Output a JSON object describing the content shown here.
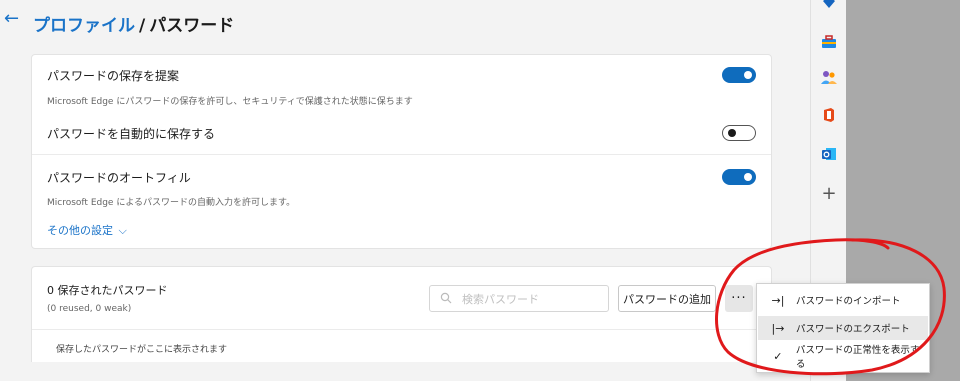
{
  "header": {
    "back_glyph": "←",
    "breadcrumb_link": "プロファイル",
    "separator": "/",
    "breadcrumb_current": "パスワード"
  },
  "settings": {
    "offer_save": {
      "title": "パスワードの保存を提案",
      "description": "Microsoft Edge にパスワードの保存を許可し、セキュリティで保護された状態に保ちます",
      "enabled": true
    },
    "auto_save": {
      "title": "パスワードを自動的に保存する",
      "enabled": false
    },
    "autofill": {
      "title": "パスワードのオートフィル",
      "description": "Microsoft Edge によるパスワードの自動入力を許可します。",
      "enabled": true
    },
    "more_settings": "その他の設定",
    "more_chevron": "⌵"
  },
  "saved": {
    "title": "0 保存されたパスワード",
    "subtitle": "(0 reused, 0 weak)",
    "search_placeholder": "検索パスワード",
    "add_button": "パスワードの追加",
    "more_button": "···",
    "empty_message": "保存したパスワードがここに表示されます"
  },
  "menu": {
    "items": [
      {
        "icon": "→|",
        "label": "パスワードのインポート",
        "highlighted": false
      },
      {
        "icon": "|→",
        "label": "パスワードのエクスポート",
        "highlighted": true
      },
      {
        "icon": "✓",
        "label": "パスワードの正常性を表示する",
        "highlighted": false
      }
    ]
  },
  "sidebar": {
    "icons": [
      "shopping-tag-icon",
      "toolbox-icon",
      "people-icon",
      "office-icon",
      "outlook-icon",
      "add-icon"
    ],
    "add_glyph": "+"
  },
  "colors": {
    "accent": "#0f6cbd",
    "link": "#1a73c8",
    "annotation": "#e0191b"
  }
}
